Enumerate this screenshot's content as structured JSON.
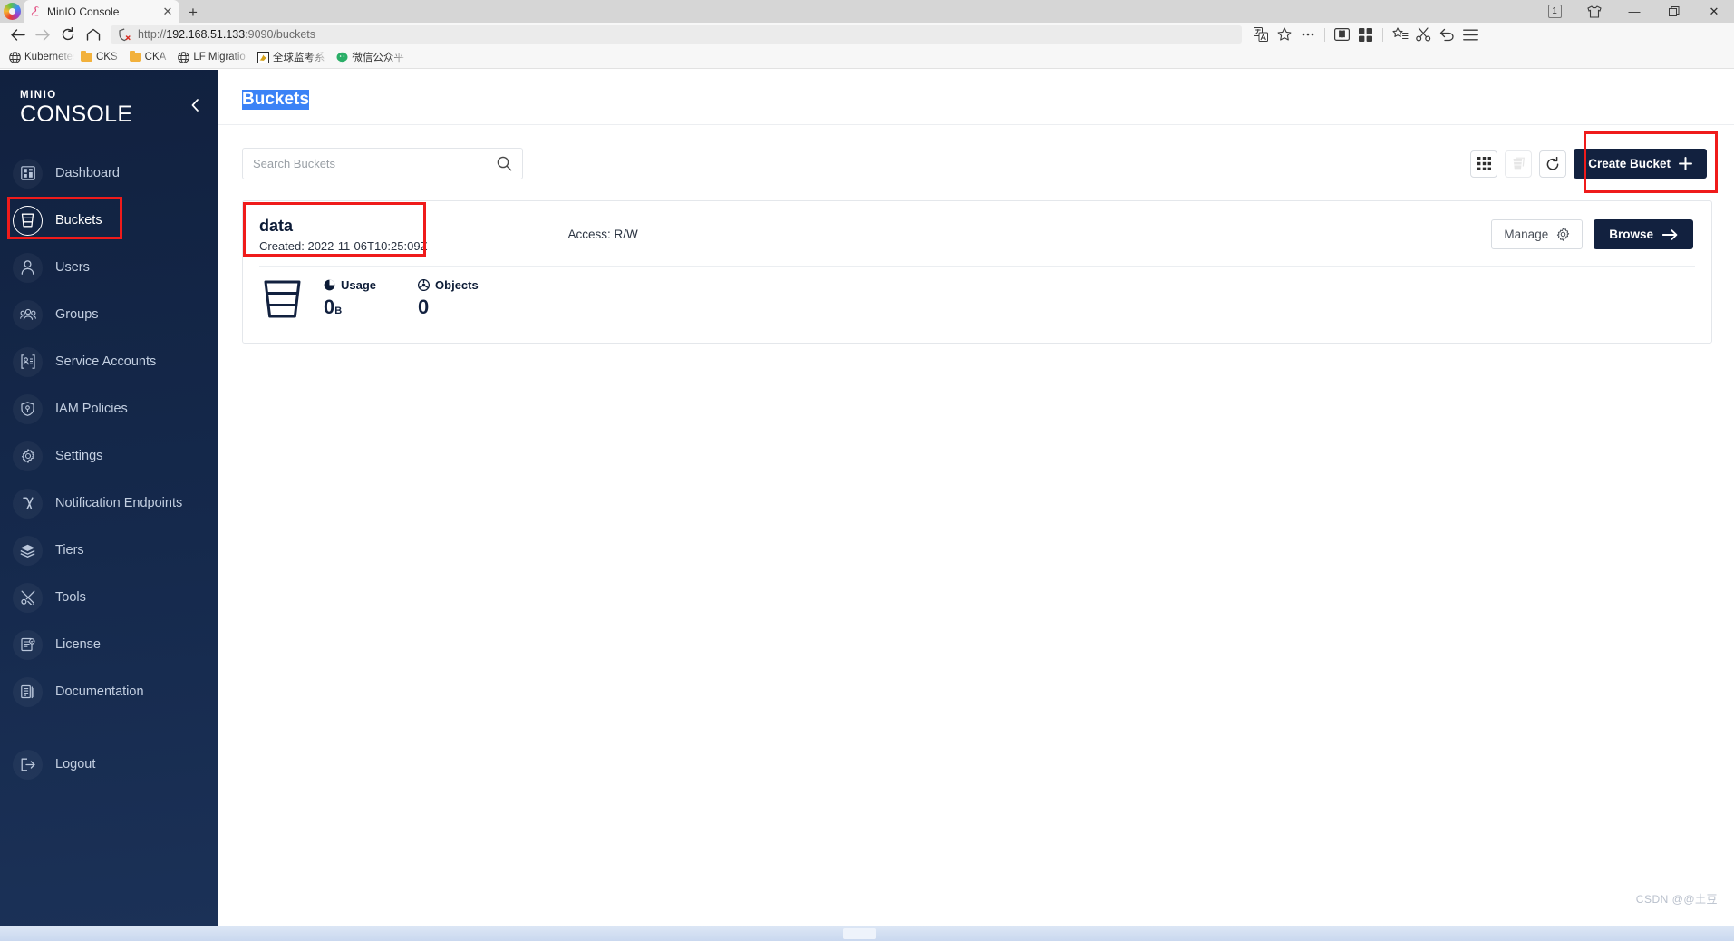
{
  "browser": {
    "tab": {
      "title": "MinIO Console",
      "favicon": "minio-flamingo-icon",
      "close_label": "✕"
    },
    "new_tab_label": "+",
    "window_controls": {
      "tab_count": "1",
      "minimize": "—",
      "restore": "❐",
      "close": "✕"
    },
    "nav": {
      "back": "←",
      "forward": "→",
      "reload": "⟳",
      "home": "⌂",
      "url_scheme": "http://",
      "url_host": "192.168.51.133",
      "url_rest": ":9090/buckets",
      "url_full": "http://192.168.51.133:9090/buckets",
      "security_icon": "insecure-shield-icon"
    },
    "bookmarks": [
      {
        "label": "Kubernetes",
        "icon": "globe-icon"
      },
      {
        "label": "CKS",
        "icon": "folder-icon"
      },
      {
        "label": "CKA",
        "icon": "folder-icon"
      },
      {
        "label": "LF Migratio",
        "icon": "globe-icon"
      },
      {
        "label": "全球监考系",
        "icon": "exam-icon"
      },
      {
        "label": "微信公众平",
        "icon": "wechat-icon"
      }
    ]
  },
  "sidebar": {
    "logo_top": "MINIO",
    "logo_bottom": "CONSOLE",
    "collapse_label": "‹",
    "items": [
      {
        "label": "Dashboard",
        "icon": "dashboard-icon",
        "active": false
      },
      {
        "label": "Buckets",
        "icon": "bucket-icon",
        "active": true
      },
      {
        "label": "Users",
        "icon": "user-icon",
        "active": false
      },
      {
        "label": "Groups",
        "icon": "groups-icon",
        "active": false
      },
      {
        "label": "Service Accounts",
        "icon": "service-account-icon",
        "active": false
      },
      {
        "label": "IAM Policies",
        "icon": "shield-icon",
        "active": false
      },
      {
        "label": "Settings",
        "icon": "gear-icon",
        "active": false
      },
      {
        "label": "Notification Endpoints",
        "icon": "lambda-icon",
        "active": false
      },
      {
        "label": "Tiers",
        "icon": "layers-icon",
        "active": false
      },
      {
        "label": "Tools",
        "icon": "tools-icon",
        "active": false
      },
      {
        "label": "License",
        "icon": "license-icon",
        "active": false
      },
      {
        "label": "Documentation",
        "icon": "document-icon",
        "active": false
      }
    ],
    "logout": {
      "label": "Logout",
      "icon": "logout-icon"
    }
  },
  "main": {
    "page_title": "Buckets",
    "search": {
      "placeholder": "Search Buckets",
      "value": "",
      "icon": "search-icon"
    },
    "toolbar_buttons": [
      {
        "name": "grid-view-button",
        "icon": "grid-icon",
        "disabled": false
      },
      {
        "name": "delete-selected-button",
        "icon": "bucket-delete-icon",
        "disabled": true
      },
      {
        "name": "refresh-button",
        "icon": "refresh-icon",
        "disabled": false
      }
    ],
    "create_bucket": {
      "label": "Create Bucket",
      "icon": "plus-icon"
    }
  },
  "bucket": {
    "name": "data",
    "created_label": "Created: 2022-11-06T10:25:09Z",
    "access_label": "Access: R/W",
    "manage": {
      "label": "Manage",
      "icon": "gear-icon"
    },
    "browse": {
      "label": "Browse",
      "icon": "arrow-right-icon"
    },
    "icon": "bucket-icon",
    "metrics": [
      {
        "label": "Usage",
        "icon": "usage-pie-icon",
        "value": "0",
        "unit": "B"
      },
      {
        "label": "Objects",
        "icon": "objects-icon",
        "value": "0",
        "unit": ""
      }
    ]
  },
  "watermark": "CSDN @@土豆",
  "colors": {
    "sidebar_bg": "#12213f",
    "primary": "#12213f",
    "highlight_red": "#ef1b1b",
    "selection_blue": "#3b82f6"
  }
}
